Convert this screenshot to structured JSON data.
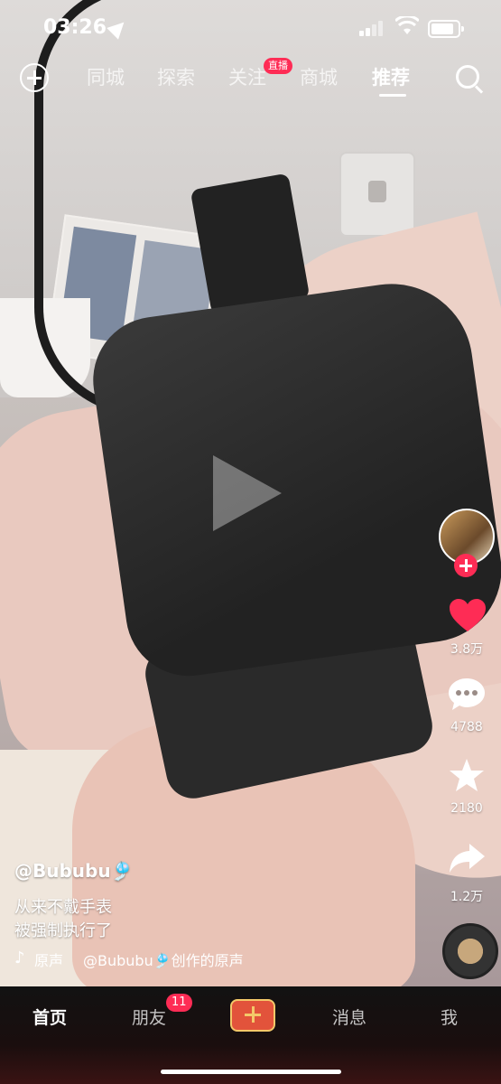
{
  "status_bar": {
    "time": "03:26"
  },
  "top_nav": {
    "tabs": [
      {
        "label": "同城"
      },
      {
        "label": "探索"
      },
      {
        "label": "关注"
      },
      {
        "label": "商城"
      },
      {
        "label": "推荐"
      }
    ],
    "live_badge": "直播",
    "active_tab": "推荐"
  },
  "actions": {
    "likes": "3.8万",
    "comments": "4788",
    "favorites": "2180",
    "shares": "1.2万"
  },
  "caption": {
    "author": "@Bububu🎐",
    "line1": "从来不戴手表",
    "line2": "被强制执行了",
    "music_prefix": "原声",
    "music": "@Bububu🎐创作的原声"
  },
  "bottom_nav": {
    "home": "首页",
    "friends": "朋友",
    "friends_badge": "11",
    "messages": "消息",
    "me": "我"
  },
  "colors": {
    "accent": "#fe2c55"
  }
}
